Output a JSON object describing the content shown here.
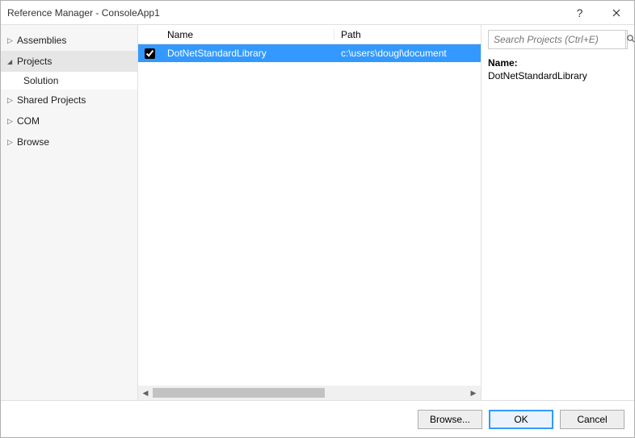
{
  "window": {
    "title": "Reference Manager - ConsoleApp1",
    "help_icon": "?"
  },
  "sidebar": {
    "items": [
      {
        "label": "Assemblies",
        "expanded": false
      },
      {
        "label": "Projects",
        "expanded": true,
        "children": [
          {
            "label": "Solution",
            "selected": true
          }
        ]
      },
      {
        "label": "Shared Projects",
        "expanded": false
      },
      {
        "label": "COM",
        "expanded": false
      },
      {
        "label": "Browse",
        "expanded": false
      }
    ]
  },
  "grid": {
    "columns": {
      "name": "Name",
      "path": "Path"
    },
    "rows": [
      {
        "checked": true,
        "name": "DotNetStandardLibrary",
        "path": "c:\\users\\dougl\\document"
      }
    ]
  },
  "search": {
    "placeholder": "Search Projects (Ctrl+E)"
  },
  "details": {
    "label": "Name:",
    "value": "DotNetStandardLibrary"
  },
  "buttons": {
    "browse": "Browse...",
    "ok": "OK",
    "cancel": "Cancel"
  }
}
